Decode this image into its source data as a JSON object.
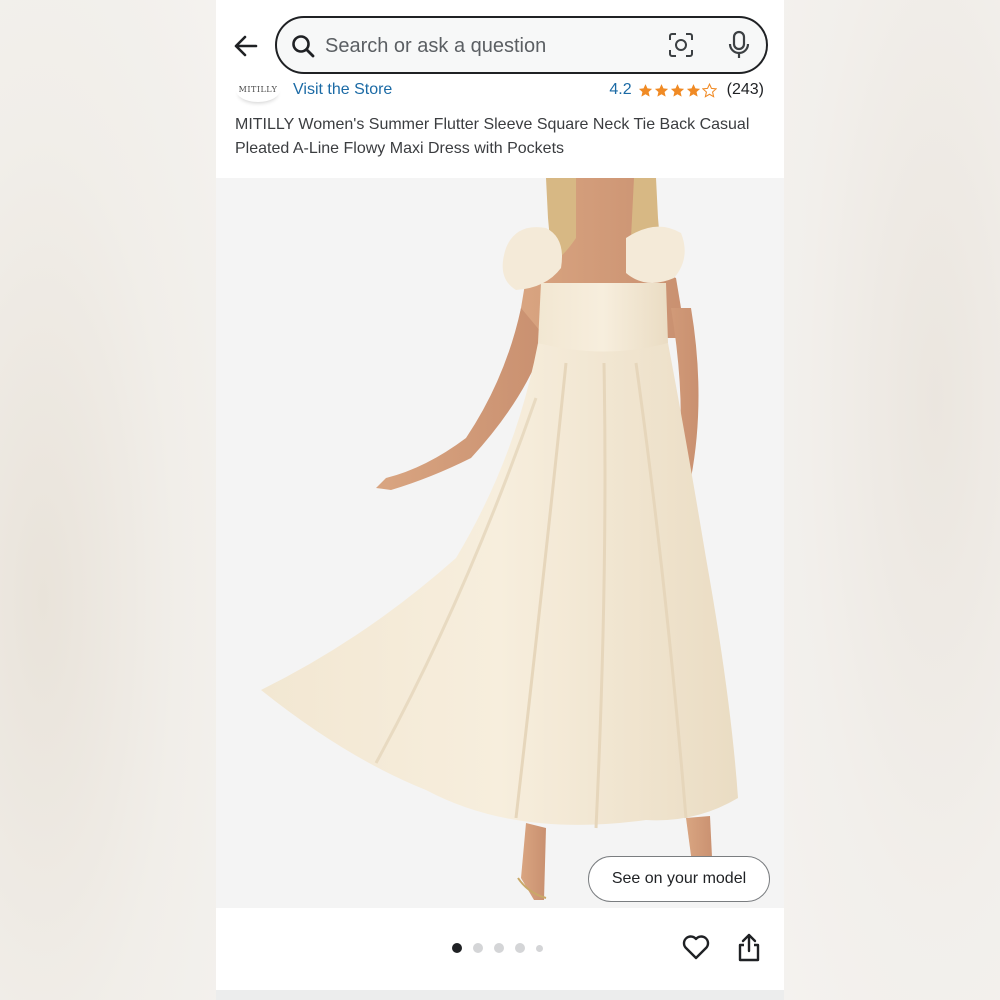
{
  "search": {
    "placeholder": "Search or ask a question"
  },
  "store": {
    "brand_logo_text": "MITILLY",
    "visit_label": "Visit the Store",
    "rating_value": "4.2",
    "rating_stars": 4.2,
    "rating_count": "(243)",
    "rating_color": "#f08a24",
    "link_color": "#1b6aa5"
  },
  "product": {
    "title": "MITILLY Women's Summer Flutter Sleeve Square Neck Tie Back Casual Pleated A-Line Flowy Maxi Dress with Pockets"
  },
  "image": {
    "see_on_model_label": "See on your model",
    "page_count": 5,
    "current_page": 1
  },
  "icons": {
    "back": "arrow-left",
    "search": "magnifier",
    "camera": "camera-scan",
    "mic": "microphone",
    "wishlist": "heart-outline",
    "share": "share-upload"
  }
}
